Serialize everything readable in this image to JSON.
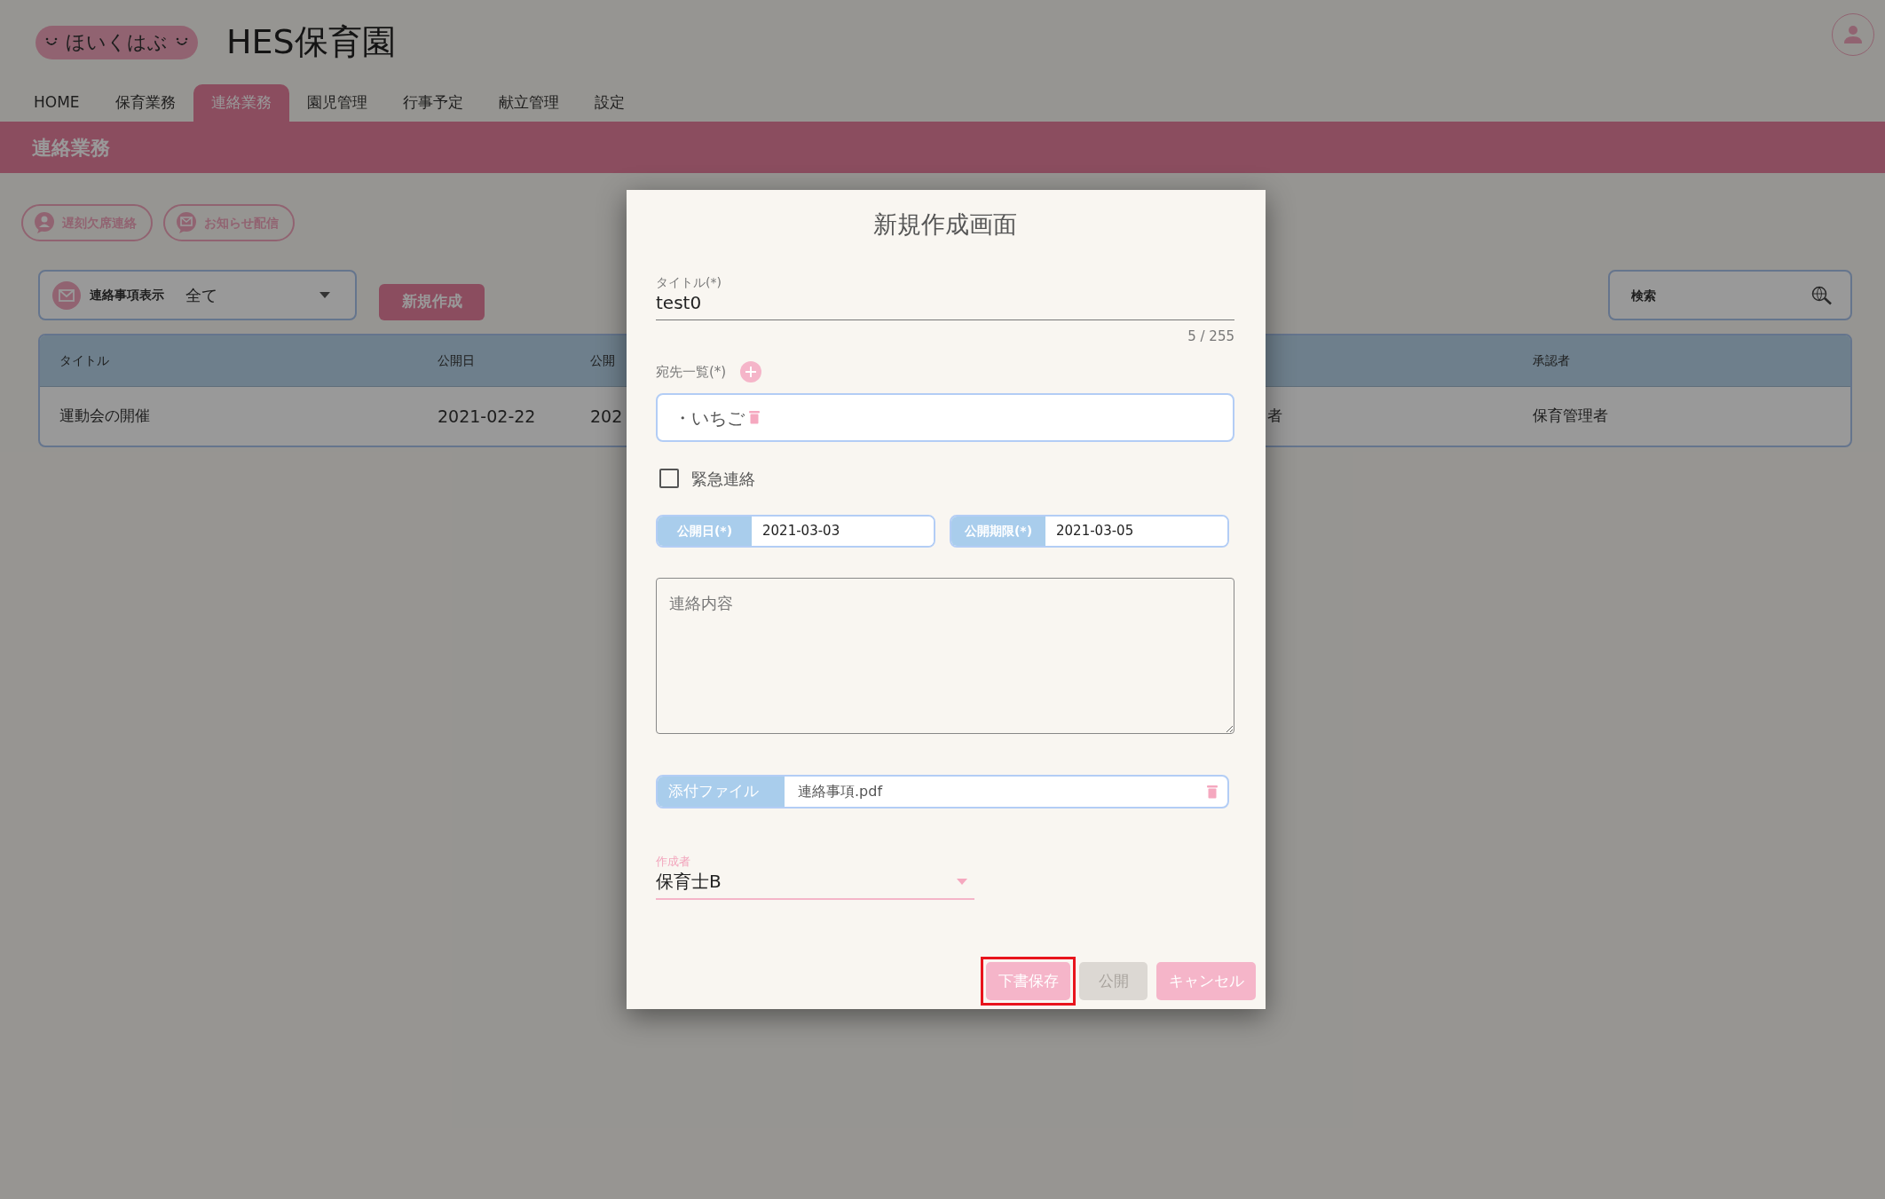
{
  "app": {
    "logo": "ほいくはぶ",
    "title": "HES保育園"
  },
  "nav_tabs": [
    {
      "label": "HOME",
      "selected": false
    },
    {
      "label": "保育業務",
      "selected": false
    },
    {
      "label": "連絡業務",
      "selected": true
    },
    {
      "label": "園児管理",
      "selected": false
    },
    {
      "label": "行事予定",
      "selected": false
    },
    {
      "label": "献立管理",
      "selected": false
    },
    {
      "label": "設定",
      "selected": false
    }
  ],
  "section_title": "連絡業務",
  "actions": [
    {
      "label": "遅刻欠席連絡",
      "kind": "absence"
    },
    {
      "label": "お知らせ配信",
      "kind": "notice"
    }
  ],
  "filter": {
    "label": "連絡事項表示",
    "value": "全て"
  },
  "new_button": "新規作成",
  "search": {
    "placeholder": "検索"
  },
  "table": {
    "columns": {
      "title": "タイトル",
      "published": "公開日",
      "column_3": "公開",
      "approver": "承認者"
    },
    "rows": [
      {
        "title": "運動会の開催",
        "published": "2021-02-22",
        "column_3": "202",
        "column_4": "者",
        "approver": "保育管理者"
      }
    ]
  },
  "dialog": {
    "title": "新規作成画面",
    "title_field": {
      "label": "タイトル(*)",
      "value": "test0",
      "counter": "5 / 255"
    },
    "recipients": {
      "label": "宛先一覧(*)",
      "items": [
        "・いちご"
      ]
    },
    "urgent": {
      "label": "緊急連絡",
      "checked": false
    },
    "dates": [
      {
        "label": "公開日(*)",
        "value": "2021-03-03"
      },
      {
        "label": "公開期限(*)",
        "value": "2021-03-05"
      }
    ],
    "content": {
      "placeholder": "連絡内容"
    },
    "attachment": {
      "label": "添付ファイル",
      "file": "連絡事項.pdf"
    },
    "author": {
      "label": "作成者",
      "value": "保育士B"
    },
    "buttons": [
      {
        "label": "下書保存",
        "disabled": false,
        "highlighted": true
      },
      {
        "label": "公開",
        "disabled": true,
        "highlighted": false
      },
      {
        "label": "キャンセル",
        "disabled": false,
        "highlighted": false
      }
    ]
  }
}
